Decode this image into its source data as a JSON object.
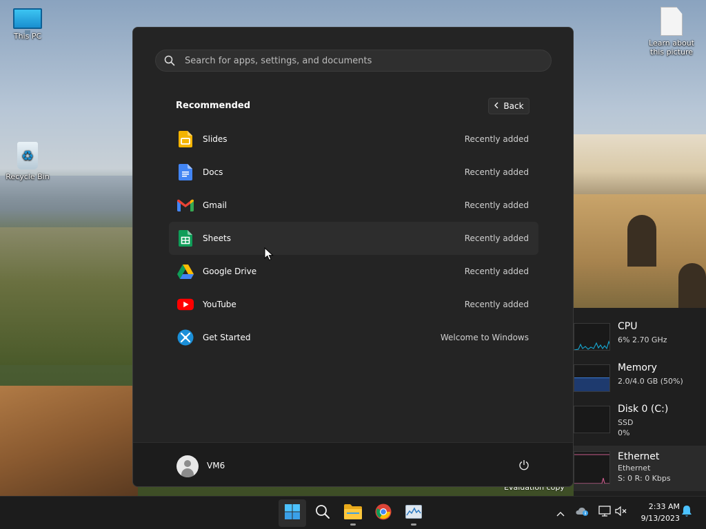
{
  "desktop": {
    "icons": [
      {
        "label": "This PC"
      },
      {
        "label": "Recycle Bin"
      },
      {
        "label": "Learn about this picture"
      }
    ],
    "evaluation_text": "Evaluation copy"
  },
  "start_menu": {
    "search": {
      "placeholder": "Search for apps, settings, and documents"
    },
    "recommended": {
      "title": "Recommended",
      "back_label": "Back",
      "items": [
        {
          "name": "Slides",
          "meta": "Recently added",
          "icon": "google-slides-icon"
        },
        {
          "name": "Docs",
          "meta": "Recently added",
          "icon": "google-docs-icon"
        },
        {
          "name": "Gmail",
          "meta": "Recently added",
          "icon": "gmail-icon"
        },
        {
          "name": "Sheets",
          "meta": "Recently added",
          "icon": "google-sheets-icon"
        },
        {
          "name": "Google Drive",
          "meta": "Recently added",
          "icon": "google-drive-icon"
        },
        {
          "name": "YouTube",
          "meta": "Recently added",
          "icon": "youtube-icon"
        },
        {
          "name": "Get Started",
          "meta": "Welcome to Windows",
          "icon": "get-started-icon"
        }
      ]
    },
    "user": {
      "name": "VM6"
    }
  },
  "task_manager": {
    "cpu": {
      "name": "CPU",
      "detail": "6% 2.70 GHz",
      "usage_percent": 6
    },
    "memory": {
      "name": "Memory",
      "detail": "2.0/4.0 GB (50%)",
      "usage_percent": 50
    },
    "disk": {
      "name": "Disk 0 (C:)",
      "type": "SSD",
      "detail": "0%",
      "usage_percent": 0
    },
    "ethernet": {
      "name": "Ethernet",
      "type": "Ethernet",
      "detail": "S: 0 R: 0 Kbps"
    }
  },
  "taskbar": {
    "apps": [
      "start-icon",
      "search-icon",
      "file-explorer-icon",
      "chrome-icon",
      "task-manager-icon"
    ],
    "clock": {
      "time": "2:33 AM",
      "date": "9/13/2023"
    }
  },
  "colors": {
    "menu_bg": "#242424",
    "accent": "#4cc2ff",
    "cpu_graph": "#17a0c8",
    "memory_graph": "#1e3a6e",
    "ethernet_graph": "#c85a8a"
  }
}
